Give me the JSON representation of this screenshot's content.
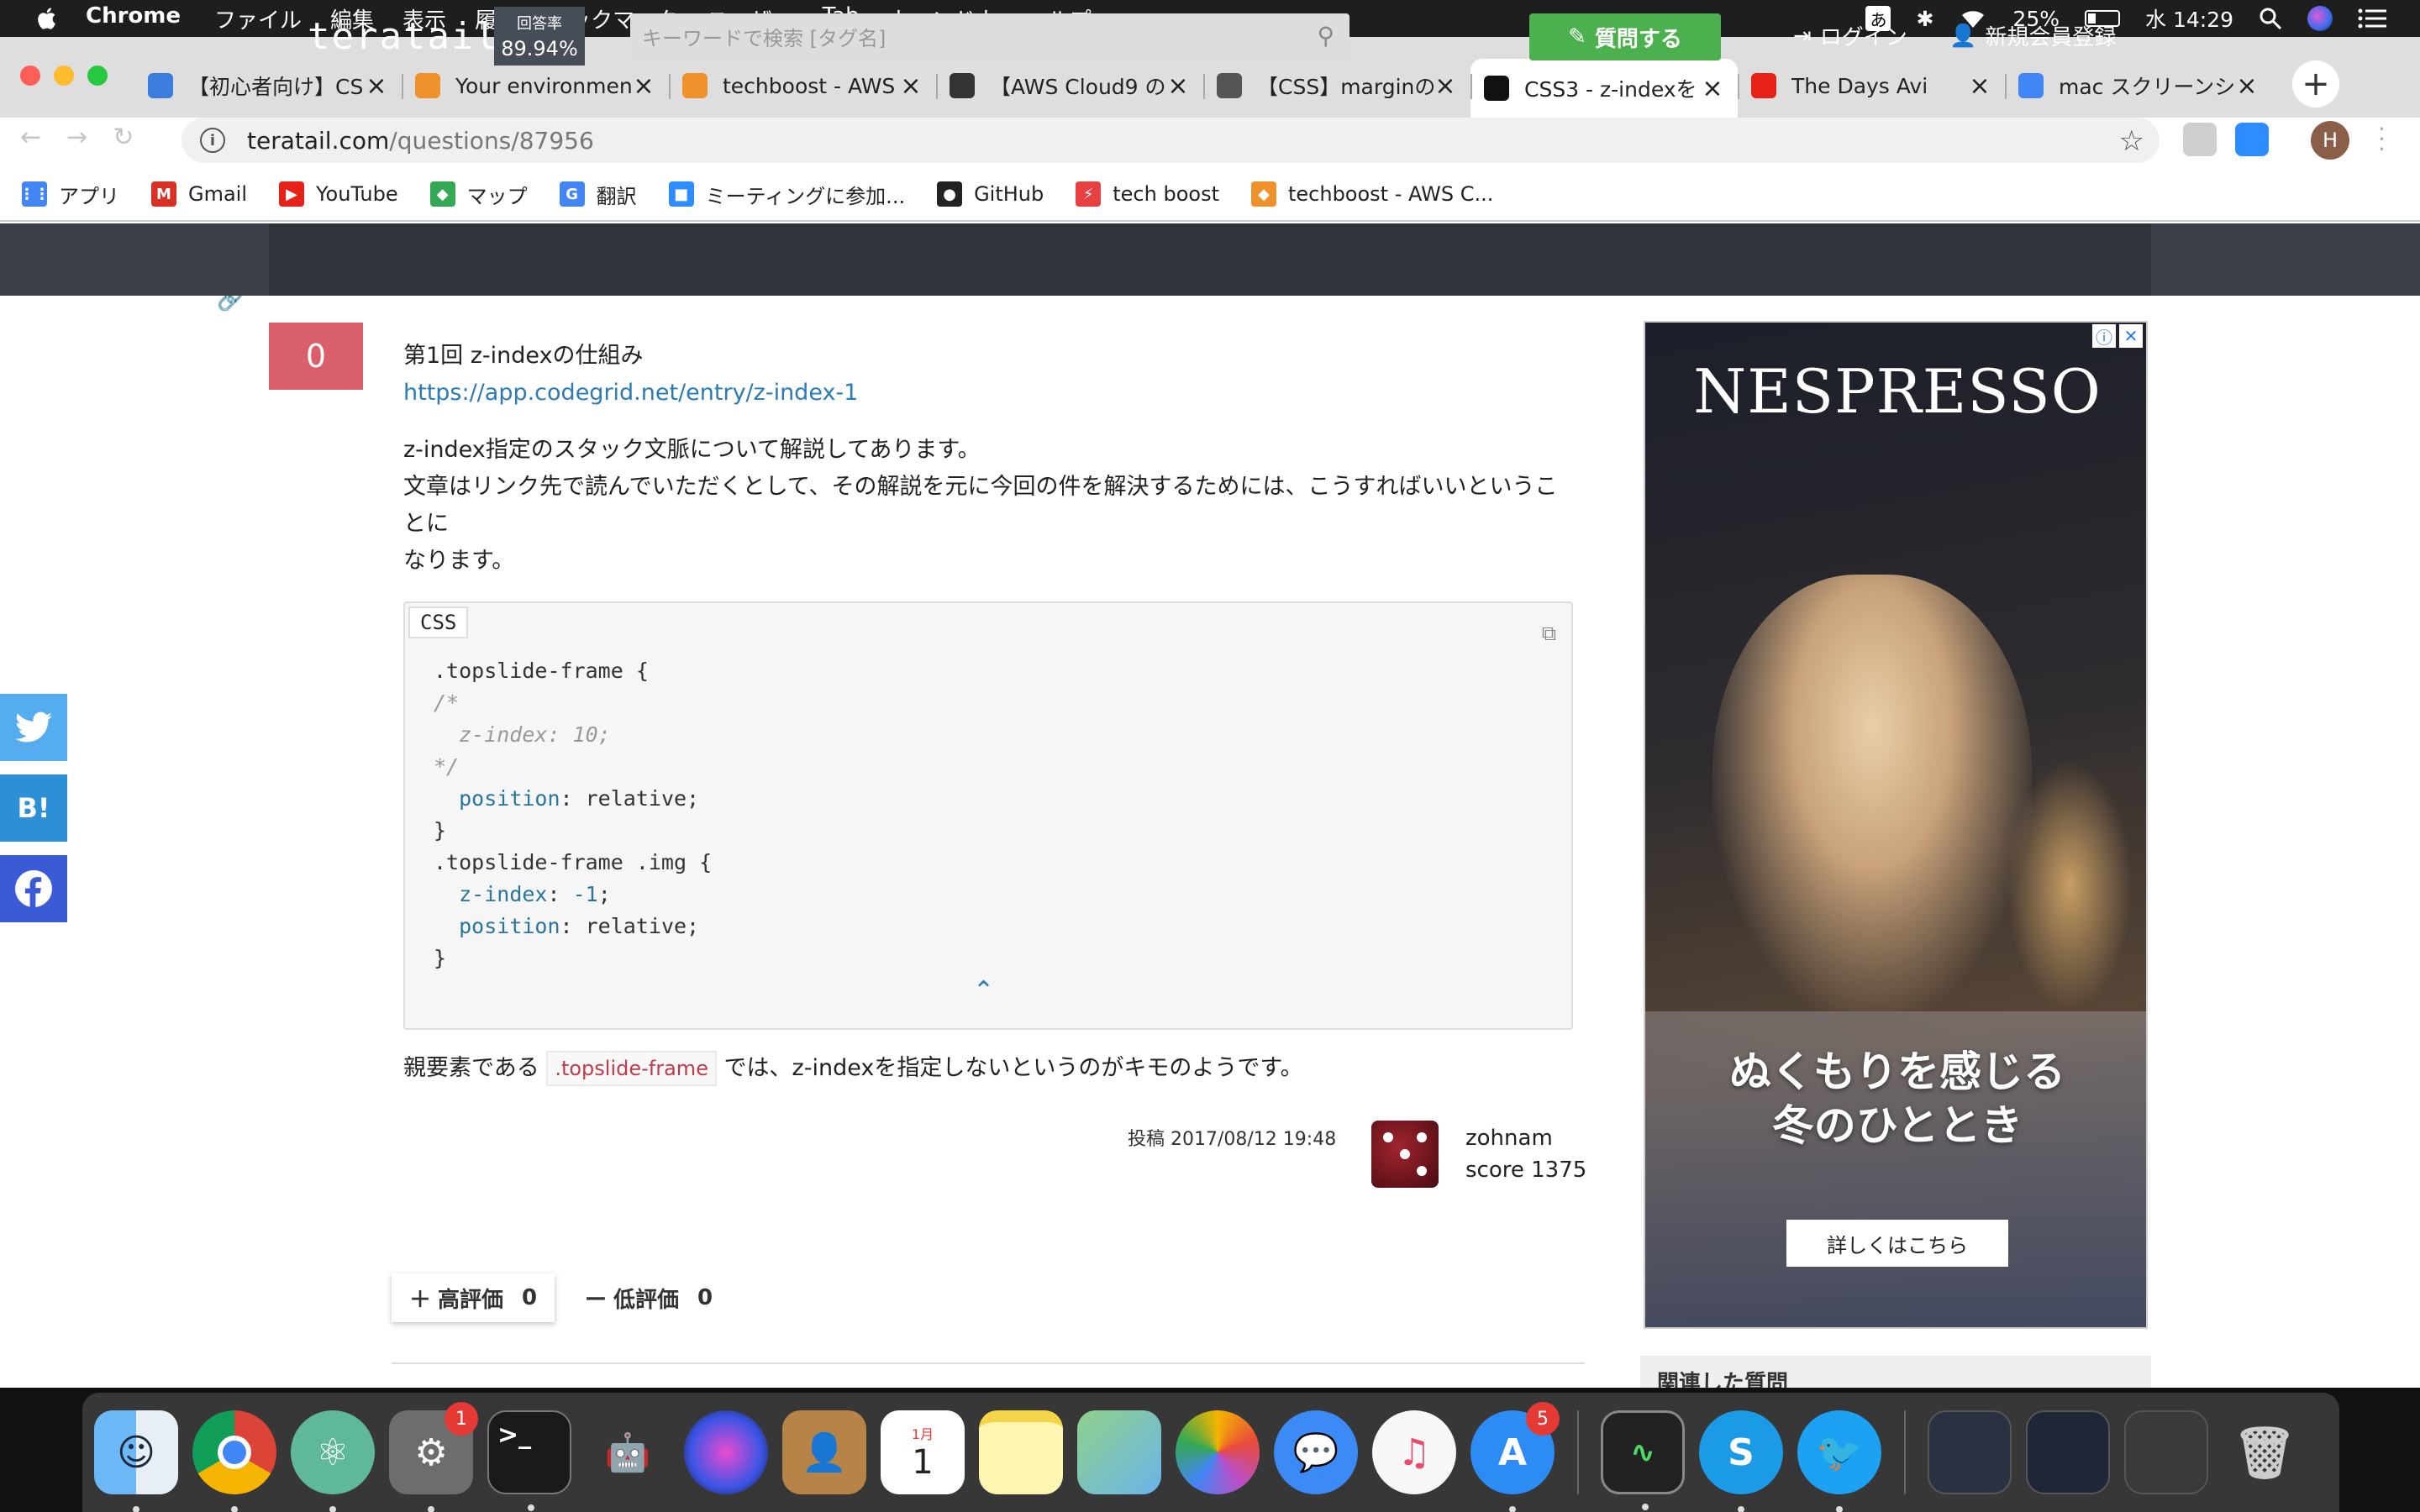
{
  "menubar": {
    "app_name": "Chrome",
    "items": [
      "ファイル",
      "編集",
      "表示",
      "履歴",
      "ブックマーク",
      "ユーザー",
      "Tab",
      "ウィンドウ",
      "ヘルプ"
    ],
    "ime": "あ",
    "battery": "25%",
    "clock": "水 14:29"
  },
  "tabs": [
    {
      "title": "【初心者向け】CSS",
      "favicon": "#3b7ddd"
    },
    {
      "title": "Your environment",
      "favicon": "#f0922b"
    },
    {
      "title": "techboost - AWS",
      "favicon": "#f0922b"
    },
    {
      "title": "【AWS Cloud9 の",
      "favicon": "#333333"
    },
    {
      "title": "【CSS】marginの",
      "favicon": "#555555"
    },
    {
      "title": "CSS3 - z-indexを",
      "favicon": "#111111"
    },
    {
      "title": "The Days Avi",
      "favicon": "#e62117"
    },
    {
      "title": "mac スクリーンシ",
      "favicon": "#4285f4"
    }
  ],
  "address": {
    "domain": "teratail.com",
    "path": "/questions/87956"
  },
  "bookmarks": [
    {
      "label": "アプリ",
      "color": "#4285f4",
      "glyph": "⋮⋮"
    },
    {
      "label": "Gmail",
      "color": "#d93025",
      "glyph": "M"
    },
    {
      "label": "YouTube",
      "color": "#e62117",
      "glyph": "▶"
    },
    {
      "label": "マップ",
      "color": "#34a853",
      "glyph": "◆"
    },
    {
      "label": "翻訳",
      "color": "#4285f4",
      "glyph": "G"
    },
    {
      "label": "ミーティングに参加...",
      "color": "#2d8cff",
      "glyph": "■"
    },
    {
      "label": "GitHub",
      "color": "#222222",
      "glyph": "●"
    },
    {
      "label": "tech boost",
      "color": "#e64040",
      "glyph": "⚡"
    },
    {
      "label": "techboost - AWS C...",
      "color": "#f0922b",
      "glyph": "◆"
    }
  ],
  "profile_initial": "H",
  "site": {
    "logo": "teratail",
    "rate_label": "回答率",
    "rate_value": "89.94%",
    "search_placeholder": "キーワードで検索 [タグ名]",
    "ask_label": "質問する",
    "login_label": "ログイン",
    "signup_label": "新規会員登録"
  },
  "answer": {
    "score": "0",
    "ref_title": "第1回 z-indexの仕組み",
    "ref_url": "https://app.codegrid.net/entry/z-index-1",
    "para1": "z-index指定のスタック文脈について解説してあります。",
    "para2": "文章はリンク先で読んでいただくとして、その解説を元に今回の件を解決するためには、こうすればいいということに",
    "para3": "なります。",
    "code_lang": "CSS",
    "after_prefix": "親要素である",
    "after_code": ".topslide-frame",
    "after_suffix": "では、z-indexを指定しないというのがキモのようです。",
    "posted": "投稿 2017/08/12 19:48",
    "author": "zohnam",
    "author_score": "score 1375",
    "upvote_label": "高評価",
    "upvote_count": "0",
    "downvote_label": "低評価",
    "downvote_count": "0"
  },
  "ad": {
    "brand": "NESPRESSO",
    "headline_1": "ぬくもりを感じる",
    "headline_2": "冬のひととき",
    "cta": "詳しくはこちら"
  },
  "related_title": "関連した質問",
  "share": {
    "hatena": "B!"
  },
  "dock": {
    "system_prefs_badge": "1",
    "calendar_month": "1月",
    "calendar_day": "1",
    "appstore_badge": "5"
  }
}
